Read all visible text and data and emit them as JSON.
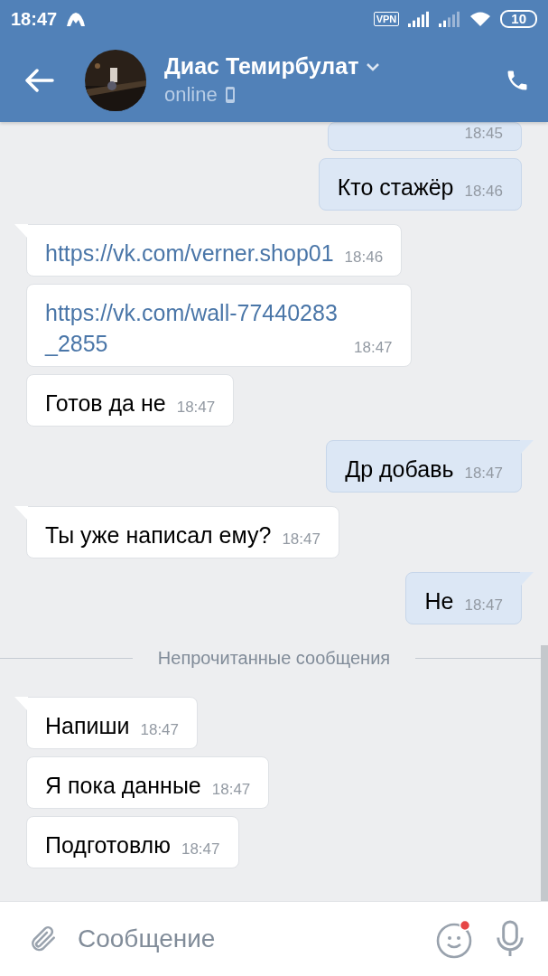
{
  "status_bar": {
    "time": "18:47",
    "vpn": "VPN",
    "battery": "10"
  },
  "header": {
    "name": "Диас Темирбулат",
    "status": "online"
  },
  "messages": [
    {
      "kind": "out",
      "time": "18:45"
    },
    {
      "kind": "out",
      "text": "Кто стажёр",
      "time": "18:46"
    },
    {
      "kind": "link",
      "text": "https://vk.com/verner.shop01",
      "time": "18:46"
    },
    {
      "kind": "link",
      "text": "https://vk.com/wall-77440283_2855",
      "time": "18:47"
    },
    {
      "kind": "in",
      "text": "Готов да не",
      "time": "18:47"
    },
    {
      "kind": "out",
      "text": "Др добавь",
      "time": "18:47"
    },
    {
      "kind": "in",
      "text": "Ты уже написал ему?",
      "time": "18:47"
    },
    {
      "kind": "out",
      "text": "Не",
      "time": "18:47"
    },
    {
      "kind": "divider",
      "text": "Непрочитанные сообщения"
    },
    {
      "kind": "in",
      "text": "Напиши",
      "time": "18:47"
    },
    {
      "kind": "in",
      "text": "Я пока данные",
      "time": "18:47"
    },
    {
      "kind": "in",
      "text": "Подготовлю",
      "time": "18:47"
    }
  ],
  "composer": {
    "placeholder": "Сообщение"
  }
}
